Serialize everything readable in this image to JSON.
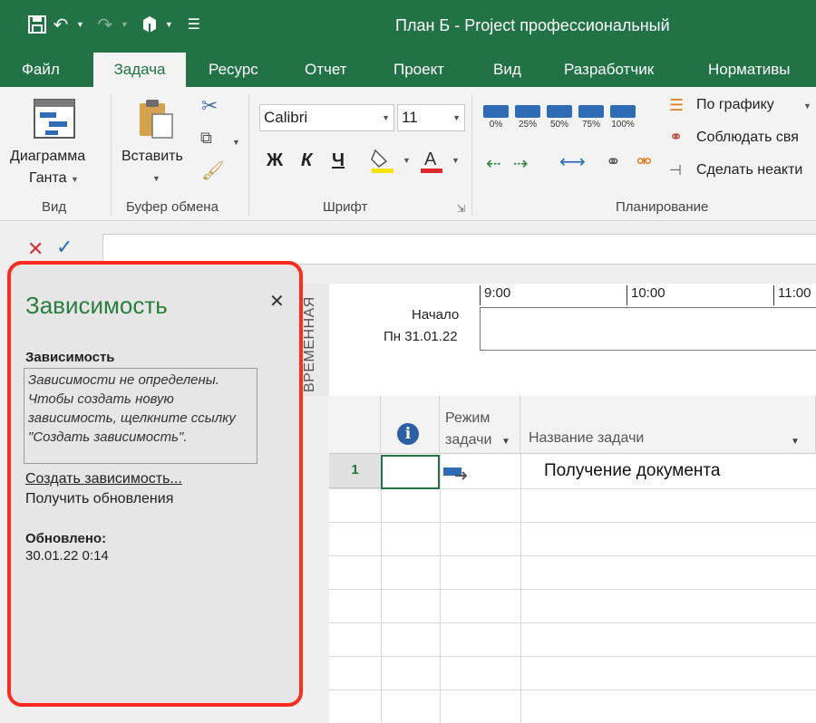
{
  "window": {
    "title": "План Б - Project профессиональный"
  },
  "tabs": [
    "Файл",
    "Задача",
    "Ресурс",
    "Отчет",
    "Проект",
    "Вид",
    "Разработчик",
    "Нормативы"
  ],
  "ribbon": {
    "view": {
      "button": "Диаграмма",
      "button2": "Ганта",
      "group": "Вид"
    },
    "clipboard": {
      "paste": "Вставить",
      "group": "Буфер обмена"
    },
    "font": {
      "name": "Calibri",
      "size": "11",
      "bold": "Ж",
      "italic": "К",
      "underline": "Ч",
      "group": "Шрифт"
    },
    "planning": {
      "progress": [
        "0%",
        "25%",
        "50%",
        "75%",
        "100%"
      ],
      "on_schedule": "По графику",
      "respect_links": "Соблюдать свя",
      "inactivate": "Сделать неакти",
      "group": "Планирование"
    }
  },
  "pane": {
    "title": "Зависимость",
    "subtitle": "Зависимость",
    "note": "Зависимости не определены. Чтобы создать новую зависимость, щелкните ссылку \"Создать зависимость\".",
    "create_link": "Создать зависимость...",
    "get_updates": "Получить обновления",
    "updated_label": "Обновлено:",
    "updated_value": "30.01.22 0:14"
  },
  "timeline": {
    "vertical_label": "ВРЕМЕННАЯ",
    "start_label": "Начало",
    "start_date": "Пн 31.01.22",
    "ticks": [
      "9:00",
      "10:00",
      "11:00"
    ]
  },
  "grid": {
    "mode_header_1": "Режим",
    "mode_header_2": "задачи",
    "name_header": "Название задачи",
    "rows": [
      {
        "num": "1",
        "name": "Получение документа"
      }
    ]
  },
  "colors": {
    "brand": "#217346",
    "highlight": "#ff2b1c",
    "pane_title": "#2a7e3f"
  }
}
